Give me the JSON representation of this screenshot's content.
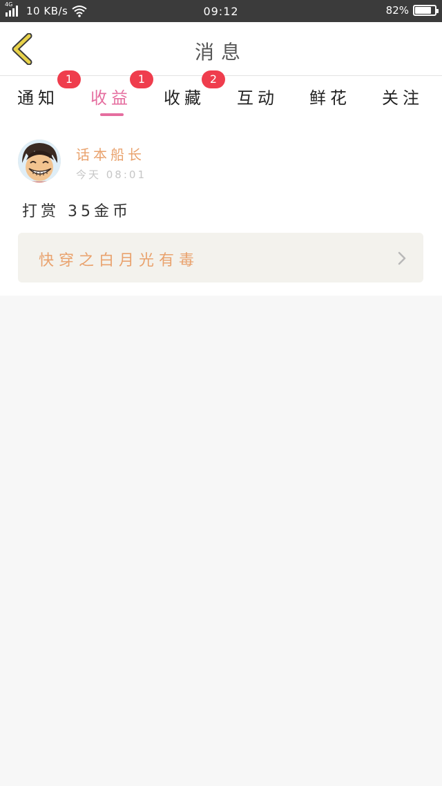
{
  "status_bar": {
    "network_type": "4G",
    "speed": "10 KB/s",
    "time": "09:12",
    "battery_percent": "82%",
    "battery_level": 0.82,
    "background_color": "#3b3b3b"
  },
  "header": {
    "title": "消息",
    "back_icon": "chevron-left-icon",
    "back_icon_color": "#e8d24a"
  },
  "tabs": [
    {
      "label": "通知",
      "badge": "1",
      "active": false
    },
    {
      "label": "收益",
      "badge": "1",
      "active": true
    },
    {
      "label": "收藏",
      "badge": "2",
      "active": false
    },
    {
      "label": "互动",
      "badge": "",
      "active": false
    },
    {
      "label": "鲜花",
      "badge": "",
      "active": false
    },
    {
      "label": "关注",
      "badge": "",
      "active": false
    }
  ],
  "colors": {
    "accent": "#e56e9f",
    "badge": "#ef3d4d",
    "name_orange": "#e9a26d",
    "card_bg": "#f3f2ed"
  },
  "message": {
    "sender": "话本船长",
    "time": "今天 08:01",
    "text": "打赏 35金币",
    "book_title": "快穿之白月光有毒",
    "avatar_icon": "cartoon-avatar-icon",
    "arrow_icon": "chevron-right-icon"
  }
}
